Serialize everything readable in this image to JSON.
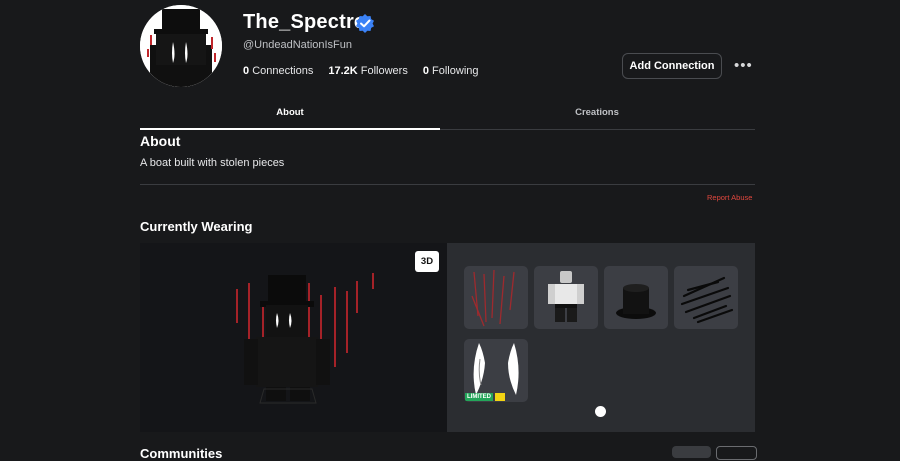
{
  "profile": {
    "display_name": "The_Spectre",
    "handle": "@UndeadNationIsFun",
    "stats": [
      {
        "value": "0",
        "label": "Connections"
      },
      {
        "value": "17.2K",
        "label": "Followers"
      },
      {
        "value": "0",
        "label": "Following"
      }
    ],
    "add_connection_label": "Add Connection",
    "more_label": "•••"
  },
  "tabs": [
    {
      "label": "About",
      "active": true
    },
    {
      "label": "Creations",
      "active": false
    }
  ],
  "about": {
    "title": "About",
    "text": "A boat built with stolen pieces",
    "report_label": "Report Abuse"
  },
  "wearing": {
    "title": "Currently Wearing",
    "view_toggle_label": "3D",
    "items": [
      {
        "name": "red-slash-accessory"
      },
      {
        "name": "classic-avatar-item"
      },
      {
        "name": "top-hat"
      },
      {
        "name": "black-spikes-accessory"
      },
      {
        "name": "white-eyes-face",
        "badge": "LIMITED"
      }
    ]
  },
  "next_section": {
    "title": "Communities"
  },
  "colors": {
    "background": "#18191b",
    "panel": "#2b2d31",
    "item_tile": "#3c3e44",
    "verified": "#3b82f6",
    "report": "#e0473e",
    "limited_badge": "#23a559"
  }
}
